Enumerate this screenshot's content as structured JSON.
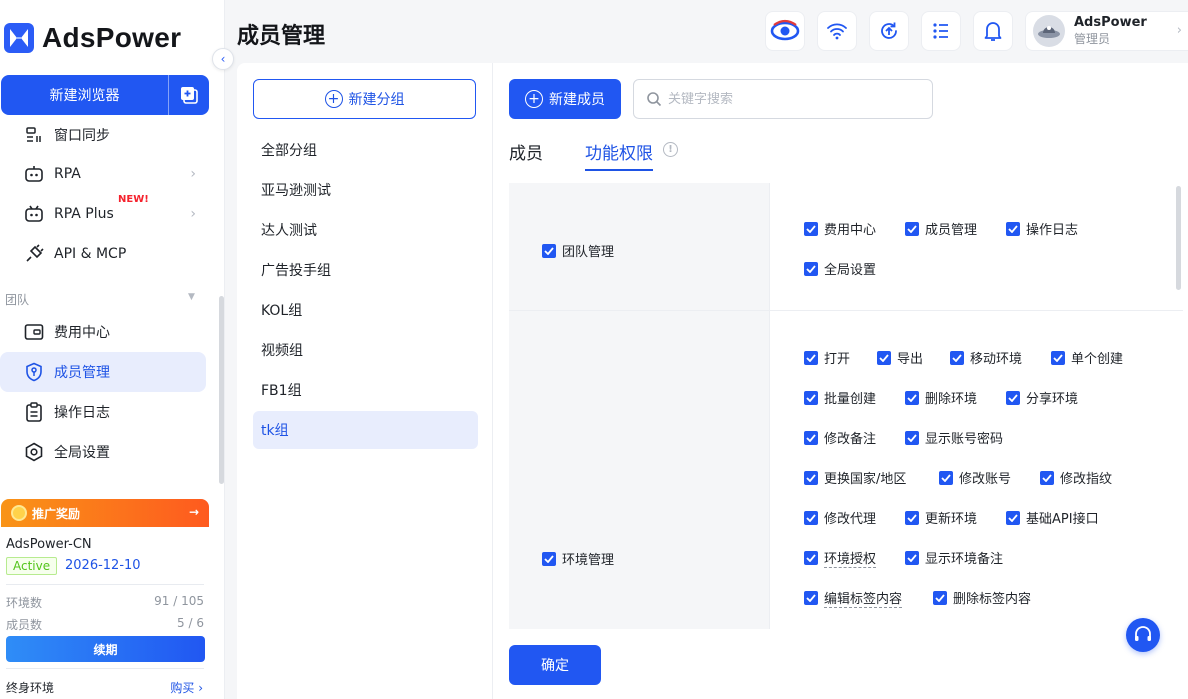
{
  "app": {
    "name": "AdsPower",
    "page_title": "成员管理"
  },
  "sidebar": {
    "new_browser_label": "新建浏览器",
    "items": [
      {
        "label": "窗口同步",
        "icon": "window-sync-icon"
      },
      {
        "label": "RPA",
        "icon": "robot-icon"
      },
      {
        "label": "RPA Plus",
        "icon": "robot-plus-icon",
        "badge": "NEW!"
      },
      {
        "label": "API & MCP",
        "icon": "plug-icon"
      }
    ],
    "team_section_label": "团队",
    "team_items": [
      {
        "label": "费用中心",
        "icon": "wallet-icon"
      },
      {
        "label": "成员管理",
        "icon": "shield-icon",
        "active": true
      },
      {
        "label": "操作日志",
        "icon": "clipboard-icon"
      },
      {
        "label": "全局设置",
        "icon": "settings-hex-icon"
      }
    ],
    "promo": {
      "title": "推广奖励",
      "arrow": "→",
      "account": "AdsPower-CN",
      "status": "Active",
      "expire_date": "2026-12-10",
      "env_label": "环境数",
      "env_value": "91 / 105",
      "member_label": "成员数",
      "member_value": "5 / 6",
      "renew_label": "续期",
      "lifetime_label": "终身环境",
      "buy_label": "购买 ›"
    }
  },
  "header": {
    "user_name": "AdsPower",
    "user_role": "管理员"
  },
  "groups": {
    "add_label": "新建分组",
    "items": [
      "全部分组",
      "亚马逊测试",
      "达人测试",
      "广告投手组",
      "KOL组",
      "视频组",
      "FB1组",
      "tk组"
    ],
    "active_index": 7
  },
  "main": {
    "add_member_label": "新建成员",
    "search_placeholder": "关键字搜索",
    "tabs": [
      "成员",
      "功能权限"
    ],
    "active_tab": 1,
    "confirm_label": "确定",
    "permissions": [
      {
        "category": "团队管理",
        "items": [
          "费用中心",
          "成员管理",
          "操作日志",
          "全局设置"
        ]
      },
      {
        "category": "环境管理",
        "items": [
          "打开",
          "导出",
          "移动环境",
          "单个创建",
          "批量创建",
          "删除环境",
          "分享环境",
          "修改备注",
          "显示账号密码",
          "更换国家/地区",
          "修改账号",
          "修改指纹",
          "修改代理",
          "更新环境",
          "基础API接口",
          "环境授权",
          "显示环境备注",
          "编辑标签内容",
          "删除标签内容"
        ]
      }
    ]
  },
  "colors": {
    "brand": "#2157f2",
    "active_bg": "#e8edfd",
    "badge_red": "#f5222d",
    "promo_orange": "#fe5a1f"
  }
}
